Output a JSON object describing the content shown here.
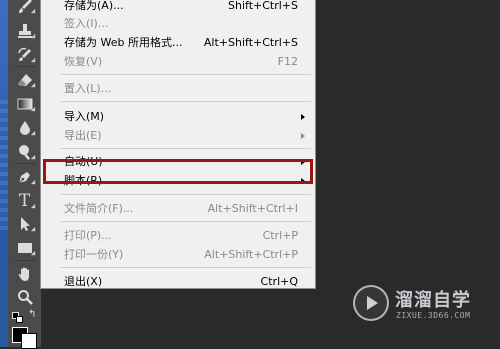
{
  "menu": {
    "items": [
      {
        "label": "存储为(A)...",
        "shortcut": "Shift+Ctrl+S",
        "enabled": true
      },
      {
        "label": "签入(I)...",
        "shortcut": "",
        "enabled": false
      },
      {
        "label": "存储为 Web 所用格式...",
        "shortcut": "Alt+Shift+Ctrl+S",
        "enabled": true
      },
      {
        "label": "恢复(V)",
        "shortcut": "F12",
        "enabled": false
      },
      {
        "label": "置入(L)...",
        "shortcut": "",
        "enabled": false
      },
      {
        "label": "导入(M)",
        "shortcut": "",
        "enabled": true,
        "submenu": true
      },
      {
        "label": "导出(E)",
        "shortcut": "",
        "enabled": false,
        "submenu": true
      },
      {
        "label": "自动(U)",
        "shortcut": "",
        "enabled": true,
        "submenu": true
      },
      {
        "label": "脚本(R)",
        "shortcut": "",
        "enabled": true,
        "submenu": true,
        "highlighted": true
      },
      {
        "label": "文件简介(F)...",
        "shortcut": "Alt+Shift+Ctrl+I",
        "enabled": false
      },
      {
        "label": "打印(P)...",
        "shortcut": "Ctrl+P",
        "enabled": false
      },
      {
        "label": "打印一份(Y)",
        "shortcut": "Alt+Shift+Ctrl+P",
        "enabled": false
      },
      {
        "label": "退出(X)",
        "shortcut": "Ctrl+Q",
        "enabled": true
      }
    ]
  },
  "toolbar": {
    "tools": [
      "brush-icon",
      "stamp-icon",
      "history-brush-icon",
      "eraser-icon",
      "gradient-icon",
      "blur-icon",
      "dodge-icon",
      "pen-icon",
      "type-icon",
      "path-select-icon",
      "rectangle-icon",
      "hand-icon",
      "zoom-icon"
    ],
    "type_tool_glyph": "T"
  },
  "watermark": {
    "title": "溜溜自学",
    "url": "ZIXUE.3D66.COM"
  },
  "colors": {
    "highlight_border": "#9b1515",
    "menu_bg": "#f0f0f0",
    "toolbar_bg": "#4b4b4b",
    "canvas_bg": "#2a2a2a"
  }
}
